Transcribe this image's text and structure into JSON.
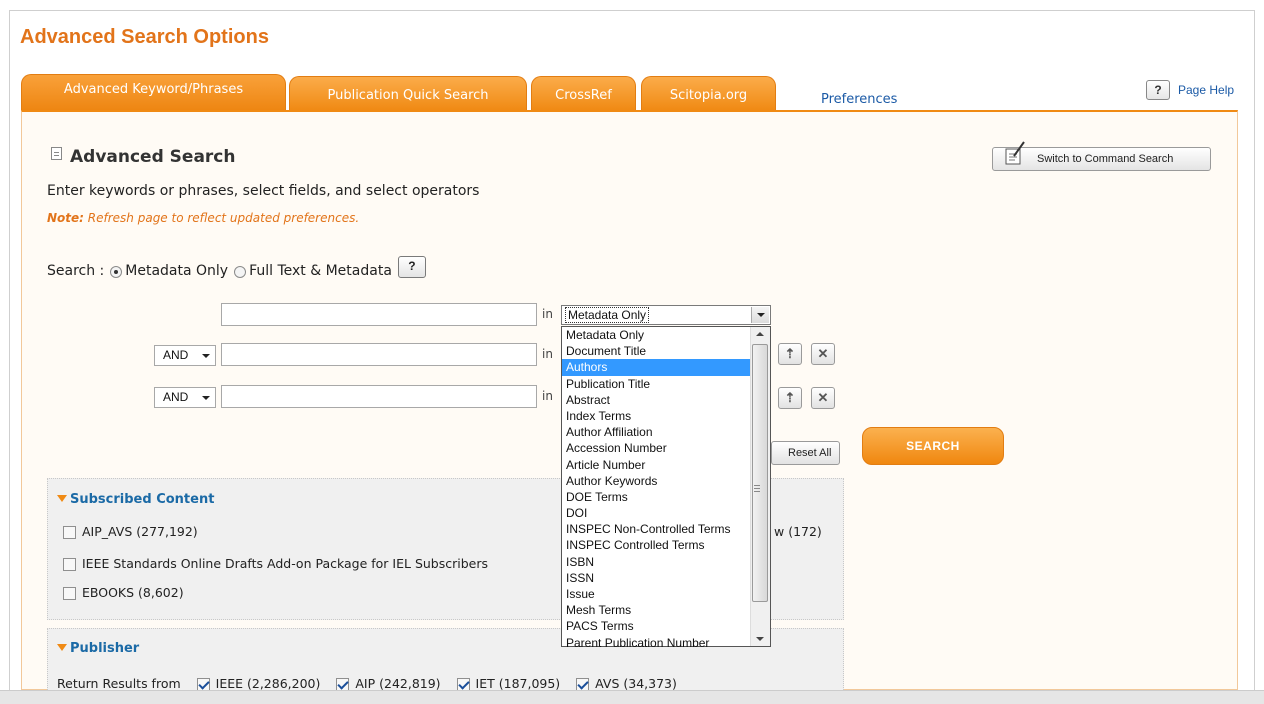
{
  "page_title": "Advanced Search Options",
  "tabs": [
    {
      "label": "Advanced Keyword/Phrases",
      "active": true
    },
    {
      "label": "Publication Quick Search",
      "active": false
    },
    {
      "label": "CrossRef",
      "active": false
    },
    {
      "label": "Scitopia.org",
      "active": false
    }
  ],
  "preferences_link": "Preferences",
  "help": {
    "button": "?",
    "label": "Page Help"
  },
  "advanced": {
    "title": "Advanced Search",
    "instructions": "Enter keywords or phrases, select fields, and select operators",
    "note_label": "Note:",
    "note_text": " Refresh page to reflect updated preferences.",
    "command_button": "Switch to Command Search"
  },
  "scope": {
    "label": "Search :",
    "options": [
      {
        "label": "Metadata Only",
        "checked": true
      },
      {
        "label": "Full Text & Metadata",
        "checked": false
      }
    ],
    "help": "?"
  },
  "rows": [
    {
      "operator": "",
      "value": "",
      "in_label": "in",
      "field": "Metadata Only"
    },
    {
      "operator": "AND",
      "value": "",
      "in_label": "in"
    },
    {
      "operator": "AND",
      "value": "",
      "in_label": "in"
    }
  ],
  "field_options": [
    "Metadata Only",
    "Document Title",
    "Authors",
    "Publication Title",
    "Abstract",
    "Index Terms",
    "Author Affiliation",
    "Accession Number",
    "Article Number",
    "Author Keywords",
    "DOE Terms",
    "DOI",
    "INSPEC Non-Controlled Terms",
    "INSPEC Controlled Terms",
    "ISBN",
    "ISSN",
    "Issue",
    "Mesh Terms",
    "PACS Terms",
    "Parent Publication Number"
  ],
  "highlighted_option": "Authors",
  "reset_label": "Reset All",
  "search_label": "SEARCH",
  "subscribed": {
    "title": "Subscribed Content",
    "items": [
      {
        "label": "AIP_AVS (277,192)",
        "checked": false
      },
      {
        "label": "IEEE Standards Online Drafts Add-on Package for IEL Subscribers",
        "checked": false
      },
      {
        "label": "EBOOKS (8,602)",
        "checked": false
      }
    ],
    "partial_right": "w (172)"
  },
  "publisher": {
    "title": "Publisher",
    "lead": "Return Results from",
    "items": [
      {
        "label": "IEEE (2,286,200)",
        "checked": true
      },
      {
        "label": "AIP (242,819)",
        "checked": true
      },
      {
        "label": "IET (187,095)",
        "checked": true
      },
      {
        "label": "AVS (34,373)",
        "checked": true
      }
    ]
  },
  "colors": {
    "accent": "#f08a14",
    "link": "#1b5aa6",
    "title": "#e2741a"
  }
}
